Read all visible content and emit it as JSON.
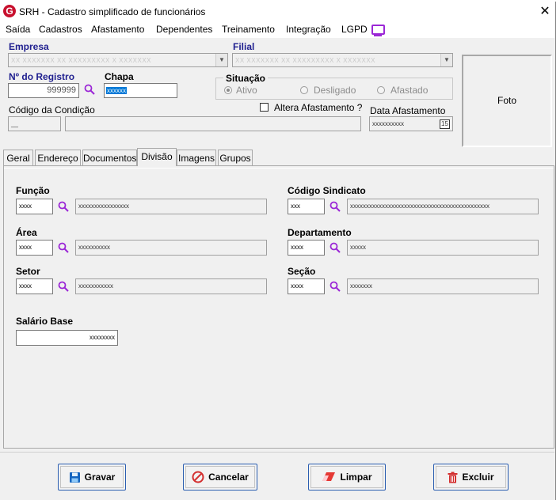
{
  "window": {
    "title": "SRH - Cadastro simplificado de funcionários",
    "close": "✕"
  },
  "menu": {
    "items": [
      "Saída",
      "Cadastros",
      "Afastamento",
      "Dependentes",
      "Treinamento",
      "Integração",
      "LGPD"
    ]
  },
  "header": {
    "empresa_label": "Empresa",
    "empresa_value": "XX XXXXXXX XX XXXXXXXXX X XXXXXXX",
    "filial_label": "Filial",
    "filial_value": "XX XXXXXXX XX XXXXXXXXX X XXXXXXX",
    "registro_label": "Nº do Registro",
    "registro_value": "999999",
    "chapa_label": "Chapa",
    "chapa_value": "xxxxxx",
    "situacao_label": "Situação",
    "situacao_options": [
      "Ativo",
      "Desligado",
      "Afastado"
    ],
    "situacao_selected": "Ativo",
    "condicao_label": "Código da Condição",
    "condicao_code": "__",
    "condicao_desc": "",
    "altera_label": "Altera Afastamento ?",
    "data_afast_label": "Data Afastamento",
    "data_afast_value": "xxxxxxxxxx",
    "calendar_glyph": "15",
    "foto_label": "Foto"
  },
  "tabs": [
    "Geral",
    "Endereço",
    "Documentos",
    "Divisão",
    "Imagens",
    "Grupos"
  ],
  "active_tab": "Divisão",
  "divisao": {
    "funcao_label": "Função",
    "funcao_code": "xxxx",
    "funcao_desc": "xxxxxxxxxxxxxxxx",
    "sindicato_label": "Código Sindicato",
    "sindicato_code": "xxx",
    "sindicato_desc": "xxxxxxxxxxxxxxxxxxxxxxxxxxxxxxxxxxxxxxxxxxxx",
    "area_label": "Área",
    "area_code": "xxxx",
    "area_desc": "xxxxxxxxxx",
    "departamento_label": "Departamento",
    "departamento_code": "xxxx",
    "departamento_desc": "xxxxx",
    "setor_label": "Setor",
    "setor_code": "xxxx",
    "setor_desc": "xxxxxxxxxxx",
    "secao_label": "Seção",
    "secao_code": "xxxx",
    "secao_desc": "xxxxxxx",
    "salario_label": "Salário Base",
    "salario_value": "xxxxxxxx"
  },
  "buttons": {
    "gravar": "Gravar",
    "cancelar": "Cancelar",
    "limpar": "Limpar",
    "excluir": "Excluir"
  },
  "colors": {
    "accent_blue": "#1f1f8f",
    "button_border": "#2a5db0",
    "magnifier": "#9b27d6",
    "logo_red": "#c8102e"
  }
}
